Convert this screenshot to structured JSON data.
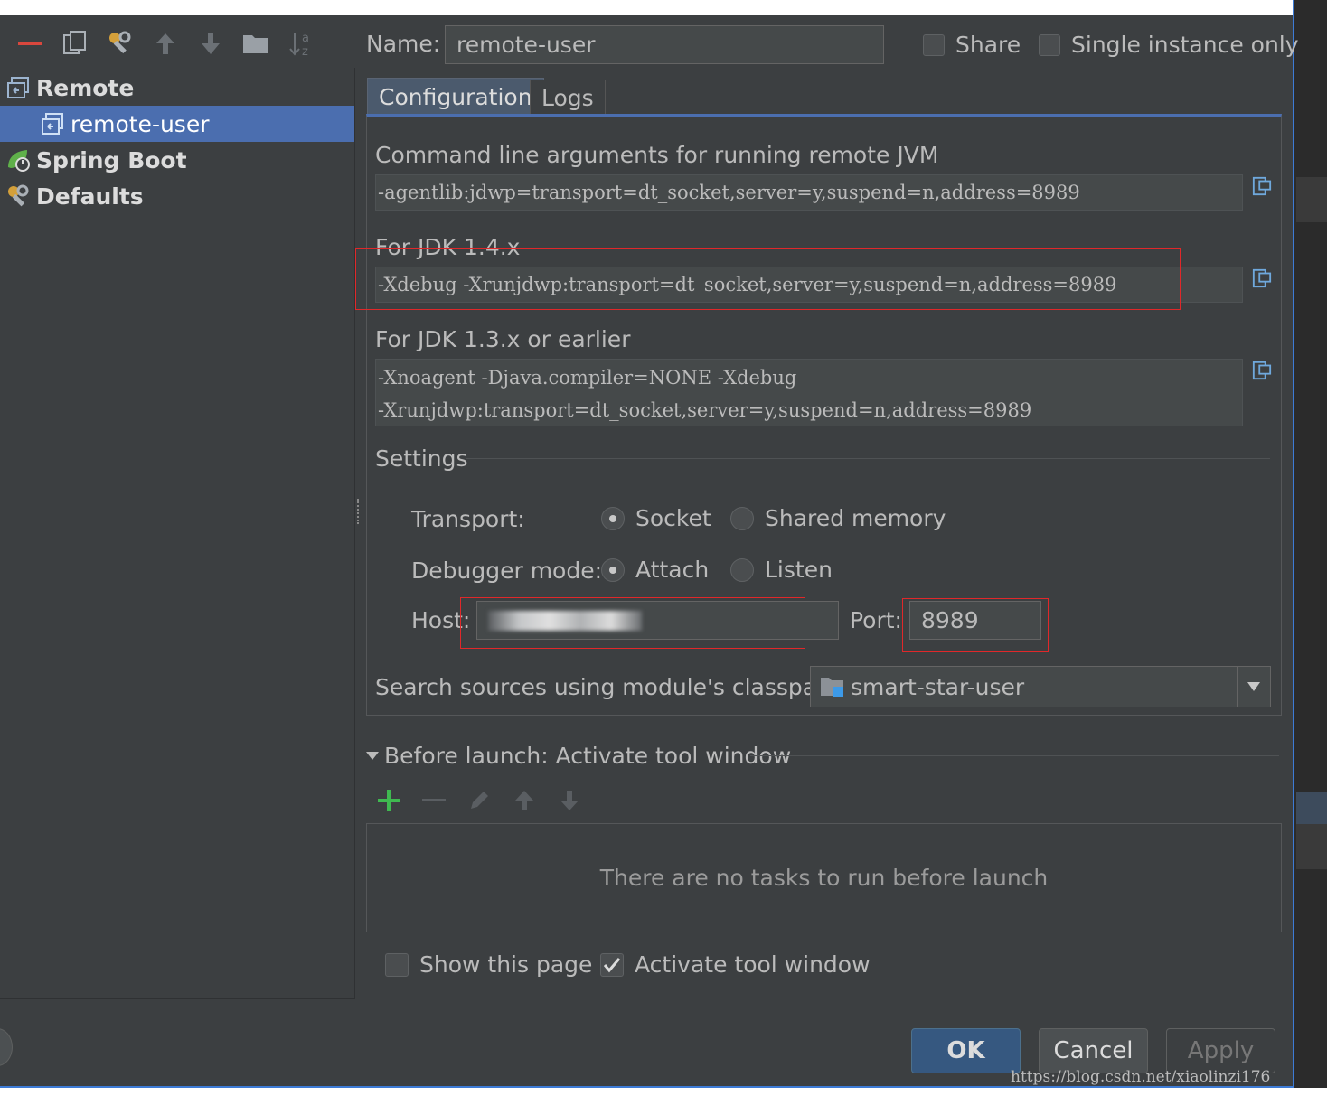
{
  "toolbar": {
    "icons": [
      "minus-icon",
      "copy-icon",
      "wrench-icon",
      "arrow-up-icon",
      "arrow-down-icon",
      "folder-icon",
      "sort-alpha-icon"
    ]
  },
  "tree": {
    "remote": "Remote",
    "remote_user": "remote-user",
    "spring_boot": "Spring Boot",
    "defaults": "Defaults"
  },
  "header": {
    "name_label": "Name:",
    "name_value": "remote-user",
    "share_label": "Share",
    "single_instance_label": "Single instance only"
  },
  "tabs": {
    "configuration": "Configuration",
    "logs": "Logs"
  },
  "config": {
    "cmd_label": "Command line arguments for running remote JVM",
    "cmd_value": "-agentlib:jdwp=transport=dt_socket,server=y,suspend=n,address=8989",
    "jdk14_label": "For JDK 1.4.x",
    "jdk14_value": "-Xdebug -Xrunjdwp:transport=dt_socket,server=y,suspend=n,address=8989",
    "jdk13_label": "For JDK 1.3.x or earlier",
    "jdk13_line1": "-Xnoagent -Djava.compiler=NONE -Xdebug",
    "jdk13_line2": "-Xrunjdwp:transport=dt_socket,server=y,suspend=n,address=8989"
  },
  "settings": {
    "title": "Settings",
    "transport_label": "Transport:",
    "transport_socket": "Socket",
    "transport_shared": "Shared memory",
    "debugger_label": "Debugger mode:",
    "debugger_attach": "Attach",
    "debugger_listen": "Listen",
    "host_label": "Host:",
    "port_label": "Port:",
    "port_value": "8989",
    "classpath_label": "Search sources using module's classpath:",
    "classpath_value": "smart-star-user"
  },
  "before_launch": {
    "title": "Before launch: Activate tool window",
    "empty_text": "There are no tasks to run before launch",
    "show_page_label": "Show this page",
    "activate_label": "Activate tool window"
  },
  "buttons": {
    "ok": "OK",
    "cancel": "Cancel",
    "apply": "Apply"
  },
  "watermark": "https://blog.csdn.net/xiaolinzi176",
  "colors": {
    "background": "#3c3f41",
    "selection": "#4b6eaf",
    "highlight_box": "#e0282a",
    "add_green": "#3fb950"
  }
}
